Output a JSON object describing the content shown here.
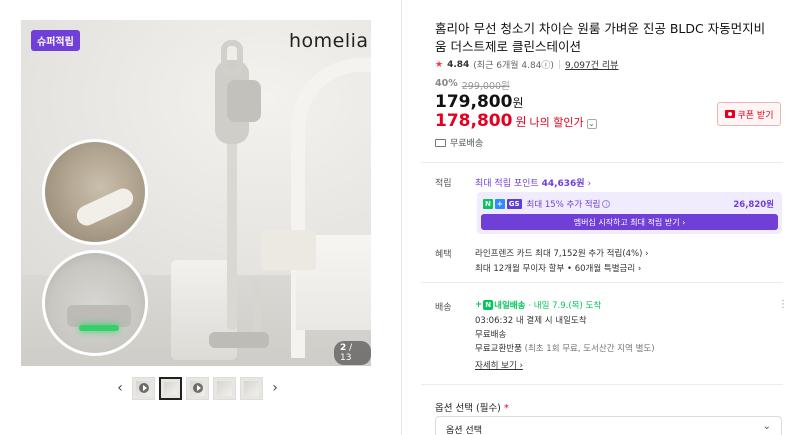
{
  "gallery": {
    "reward_badge": "슈퍼적립",
    "brand_logo": "homelia",
    "counter_current": "2",
    "counter_total": "/ 13",
    "prev_arrow": "‹",
    "next_arrow": "›"
  },
  "product": {
    "title": "홈리아 무선 청소기 차이슨 원룸 가벼운 진공 BLDC 자동먼지비움 더스트제로 클린스테이션",
    "rating_score": "4.84",
    "rating_recent": "(최근 6개월 4.84ⓘ)",
    "review_count": "9,097건 리뷰",
    "discount_rate": "40%",
    "original_price": "299,000원",
    "sale_price": "179,800",
    "sale_price_unit": "원",
    "member_price": "178,800",
    "member_price_unit": "원",
    "member_price_label": "나의 할인가",
    "coupon_label": "쿠폰 받기",
    "free_shipping": "무료배송"
  },
  "points": {
    "label": "적립",
    "max_points_prefix": "최대 적립 포인트",
    "max_points_value": "44,636원",
    "membership_text": "최대 15% 추가 적립",
    "membership_total": "26,820원",
    "membership_badges": [
      "N",
      "+",
      "GS"
    ],
    "membership_cta": "멤버십 시작하고 최대 적립 받기 ›"
  },
  "benefits": {
    "label": "혜택",
    "line_1": "라인프렌즈 카드 최대 7,152원 추가 적립(4%) ›",
    "line_2": "최대 12개월 무이자 할부 • 60개월 특별금리 ›"
  },
  "delivery": {
    "label": "배송",
    "badge_text": "내일배송",
    "arrival": "· 내일 7.9.(목) 도착",
    "order_deadline": "03:06:32  내 결제 시 내일도착",
    "fee": "무료배송",
    "return_main": "무료교환반품",
    "return_note": "(최초 1회 무료, 도서산간 지역 별도)",
    "detail_link": "자세히 보기 ›",
    "more_icon": "⋮"
  },
  "options": {
    "label": "옵션 선택 (필수)",
    "required_mark": "*",
    "select_value": "옵션 선택"
  },
  "colors": {
    "accent_red": "#e50020",
    "accent_purple": "#6f3fd8",
    "naver_green": "#03c75a"
  }
}
